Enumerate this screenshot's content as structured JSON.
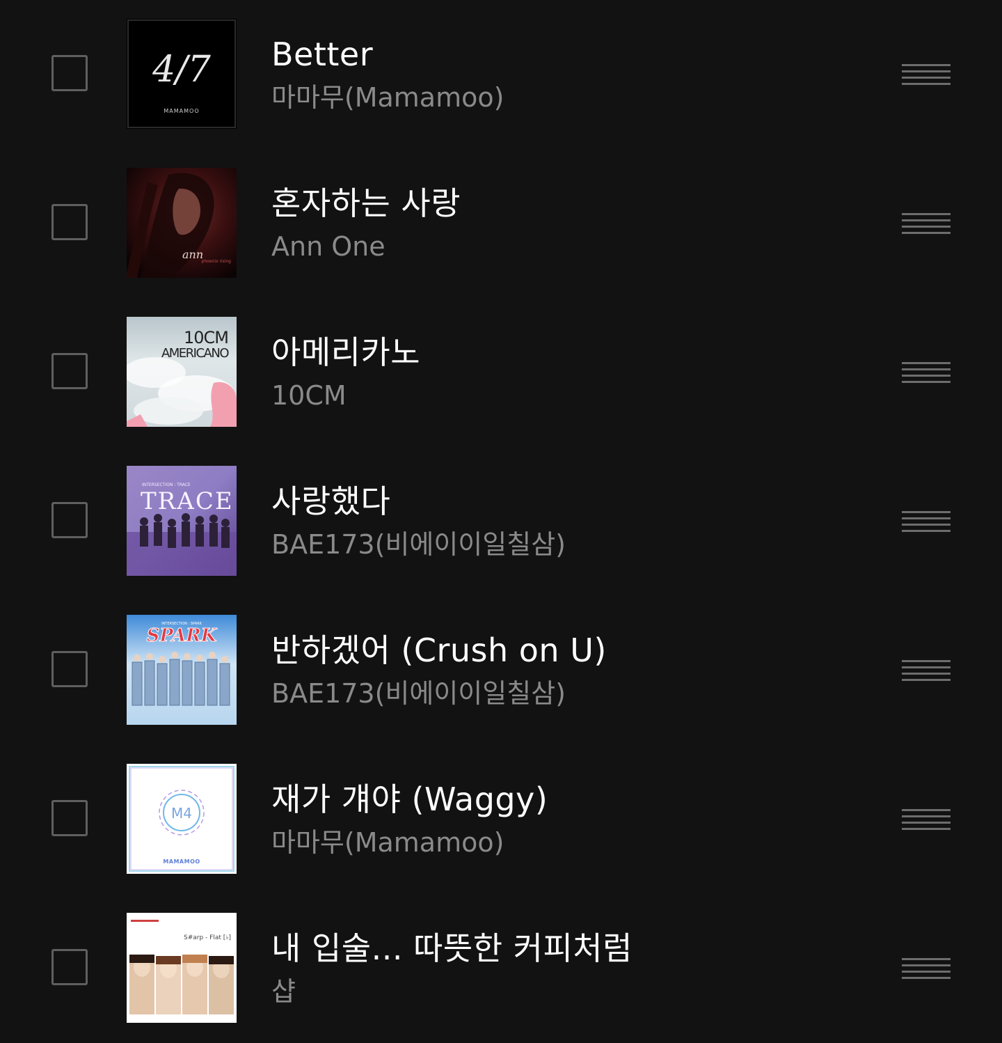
{
  "colors": {
    "background": "#121212",
    "title": "#ffffff",
    "artist": "#8a8a8a",
    "checkbox_border": "#5f5f5f",
    "drag_handle": "#6d6d6d"
  },
  "tracks": [
    {
      "title": "Better",
      "artist": "마마무(Mamamoo)",
      "selected": false,
      "cover": {
        "mark": "4/7",
        "label": "MAMAMOO"
      }
    },
    {
      "title": "혼자하는 사랑",
      "artist": "Ann One",
      "selected": false,
      "cover": {
        "mark": "ann",
        "label": "phoenix rising"
      }
    },
    {
      "title": "아메리카노",
      "artist": "10CM",
      "selected": false,
      "cover": {
        "mark": "10CM",
        "label": "AMERICANO"
      }
    },
    {
      "title": "사랑했다",
      "artist": "BAE173(비에이이일칠삼)",
      "selected": false,
      "cover": {
        "mark": "INTERSECTION : TRACE",
        "label": "TRACE"
      }
    },
    {
      "title": "반하겠어 (Crush on U)",
      "artist": "BAE173(비에이이일칠삼)",
      "selected": false,
      "cover": {
        "mark": "INTERSECTION : SPARK",
        "label": "SPARK"
      }
    },
    {
      "title": "재가 걔야 (Waggy)",
      "artist": "마마무(Mamamoo)",
      "selected": false,
      "cover": {
        "mark": "M4",
        "label": "MAMAMOO"
      }
    },
    {
      "title": "내 입술... 따뜻한 커피처럼",
      "artist": "샵",
      "selected": false,
      "cover": {
        "mark": "S#arp - Flat [♭]",
        "label": ""
      }
    }
  ]
}
